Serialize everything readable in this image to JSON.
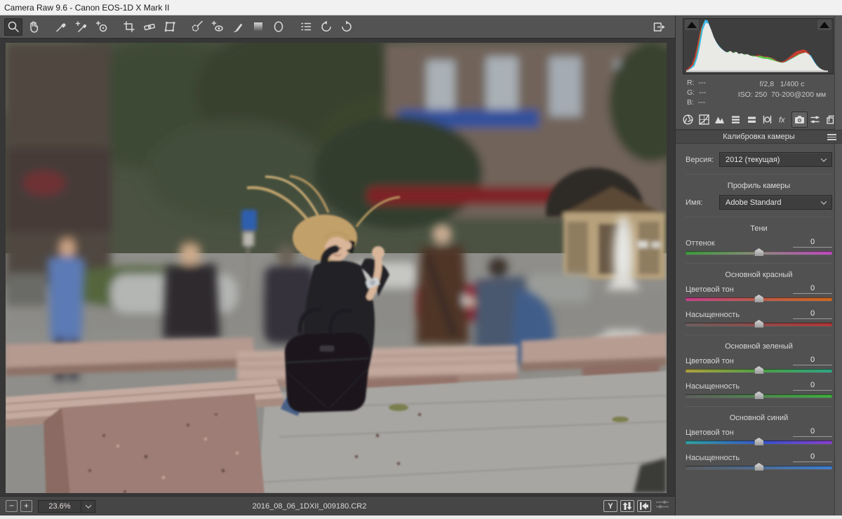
{
  "window": {
    "title": "Camera Raw 9.6  -  Canon EOS-1D X Mark II"
  },
  "toolbar": {
    "tools": [
      "zoom",
      "hand",
      "white-balance",
      "color-sampler",
      "targeted-adjustment",
      "crop",
      "straighten",
      "transform",
      "spot-removal",
      "red-eye",
      "adjustment-brush",
      "graduated-filter",
      "radial-filter",
      "preferences",
      "rotate-left",
      "rotate-right"
    ],
    "selected_tool": "zoom",
    "fullscreen": "toggle-fullscreen"
  },
  "histogram": {
    "left_indicator": "shadow-clipping",
    "right_indicator": "highlight-clipping"
  },
  "exif": {
    "r_label": "R:",
    "g_label": "G:",
    "b_label": "B:",
    "r": "---",
    "g": "---",
    "b": "---",
    "aperture": "f/2,8",
    "shutter": "1/400 c",
    "iso": "ISO: 250",
    "lens": "70-200@200 мм"
  },
  "tabs": {
    "items": [
      "basic",
      "tone-curve",
      "detail",
      "hsl-grayscale",
      "split-toning",
      "lens-corrections",
      "effects",
      "camera-calibration",
      "presets",
      "snapshots"
    ],
    "selected": "camera-calibration",
    "fx_label": "fx"
  },
  "calibration": {
    "title": "Калибровка камеры",
    "version_label": "Версия:",
    "version": "2012 (текущая)",
    "profile_title": "Профиль камеры",
    "name_label": "Имя:",
    "profile": "Adobe Standard",
    "shadows_title": "Тени",
    "tint_label": "Оттенок",
    "tint_value": "0",
    "red_title": "Основной красный",
    "green_title": "Основной зеленый",
    "blue_title": "Основной синий",
    "hue_label": "Цветовой тон",
    "sat_label": "Насыщенность",
    "red_hue": "0",
    "red_sat": "0",
    "green_hue": "0",
    "green_sat": "0",
    "blue_hue": "0",
    "blue_sat": "0"
  },
  "statusbar": {
    "zoom_out": "−",
    "zoom_in": "+",
    "zoom_level": "23.6%",
    "filename": "2016_08_06_1DXII_009180.CR2",
    "before_after_label": "Y"
  },
  "colors": {
    "clip_indicator": "#0c0c0c",
    "panel_bg": "#515151",
    "canvas_bg": "#373737"
  }
}
